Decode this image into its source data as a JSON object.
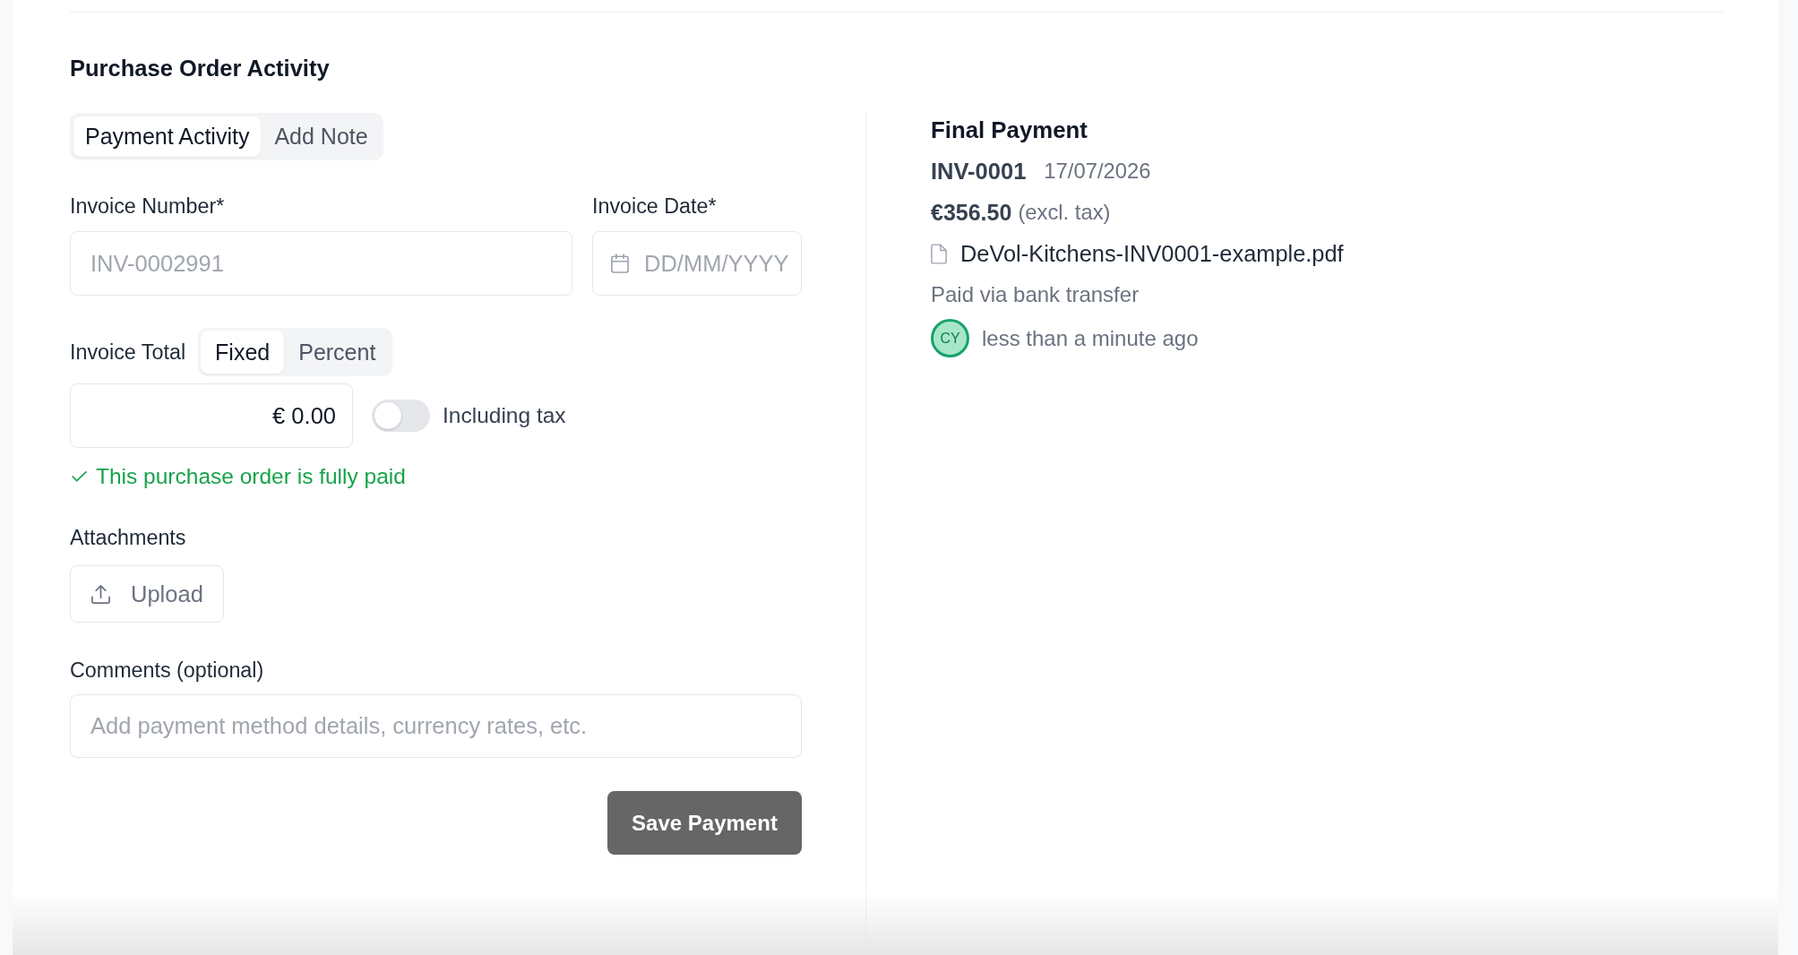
{
  "section": {
    "title": "Purchase Order Activity"
  },
  "tabs": [
    {
      "label": "Payment Activity",
      "selected": true
    },
    {
      "label": "Add Note",
      "selected": false
    }
  ],
  "form": {
    "invoice_number": {
      "label": "Invoice Number*",
      "placeholder": "INV-0002991"
    },
    "invoice_date": {
      "label": "Invoice Date*",
      "placeholder": "DD/MM/YYYY"
    },
    "invoice_total": {
      "label": "Invoice Total",
      "modes": [
        {
          "label": "Fixed",
          "selected": true
        },
        {
          "label": "Percent",
          "selected": false
        }
      ],
      "value": "€ 0.00"
    },
    "including_tax": {
      "label": "Including tax",
      "on": false
    },
    "status_message": "This purchase order is fully paid",
    "attachments": {
      "label": "Attachments",
      "button": "Upload"
    },
    "comments": {
      "label": "Comments (optional)",
      "placeholder": "Add payment method details, currency rates, etc."
    },
    "submit": {
      "label": "Save Payment"
    }
  },
  "payment": {
    "title": "Final Payment",
    "invoice": "INV-0001",
    "date": "17/07/2026",
    "amount": "€356.50",
    "amount_note": "(excl. tax)",
    "file": "DeVol-Kitchens-INV0001-example.pdf",
    "method": "Paid via bank transfer",
    "user_initials": "CY",
    "time": "less than a minute ago"
  }
}
